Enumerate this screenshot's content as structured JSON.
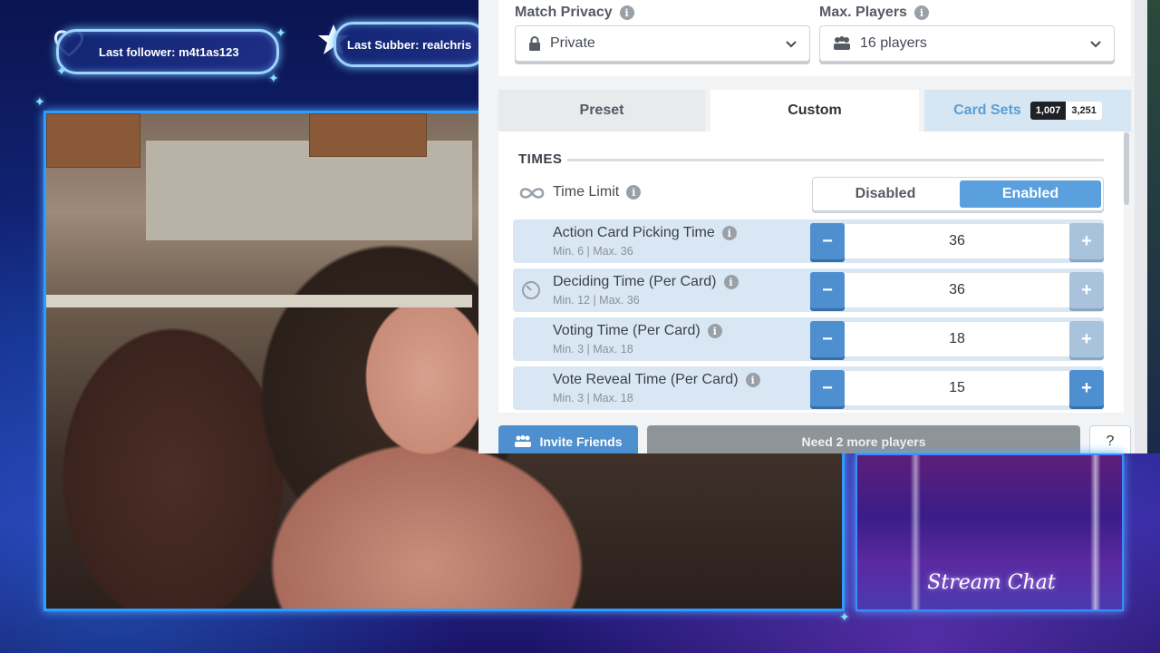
{
  "overlay": {
    "last_follower": "Last follower: m4t1as123",
    "last_subber": "Last Subber: realchris"
  },
  "game": {
    "match_privacy_label": "Match Privacy",
    "match_privacy_value": "Private",
    "max_players_label": "Max. Players",
    "max_players_value": "16 players",
    "tabs": [
      {
        "label": "Preset"
      },
      {
        "label": "Custom"
      },
      {
        "label": "Card Sets"
      }
    ],
    "card_sets_count_a": "1,007",
    "card_sets_count_b": "3,251",
    "section_title": "TIMES",
    "time_limit_label": "Time Limit",
    "toggle_disabled": "Disabled",
    "toggle_enabled": "Enabled",
    "time_rows": [
      {
        "name": "Action Card Picking Time",
        "range": "Min. 6 | Max. 36",
        "value": "36"
      },
      {
        "name": "Deciding Time (Per Card)",
        "range": "Min. 12 | Max. 36",
        "value": "36"
      },
      {
        "name": "Voting Time (Per Card)",
        "range": "Min. 3 | Max. 18",
        "value": "18"
      },
      {
        "name": "Vote Reveal Time (Per Card)",
        "range": "Min. 3 | Max. 18",
        "value": "15"
      }
    ],
    "invite_label": "Invite Friends",
    "need_players_label": "Need 2 more players",
    "help_label": "?"
  },
  "chat": {
    "title": "Stream Chat"
  },
  "icons": {
    "info": "info-icon",
    "lock": "lock-icon",
    "players": "users-icon",
    "chevron": "chevron-down-icon",
    "infinity": "infinity-icon",
    "clock": "timer-icon",
    "heart": "heart-icon",
    "star": "star-icon"
  },
  "colors": {
    "accent_blue": "#4e8fcf",
    "toggle_on": "#5aa0de",
    "row_bg": "#d9e7f4",
    "overlay_glow": "#2f9cff"
  }
}
